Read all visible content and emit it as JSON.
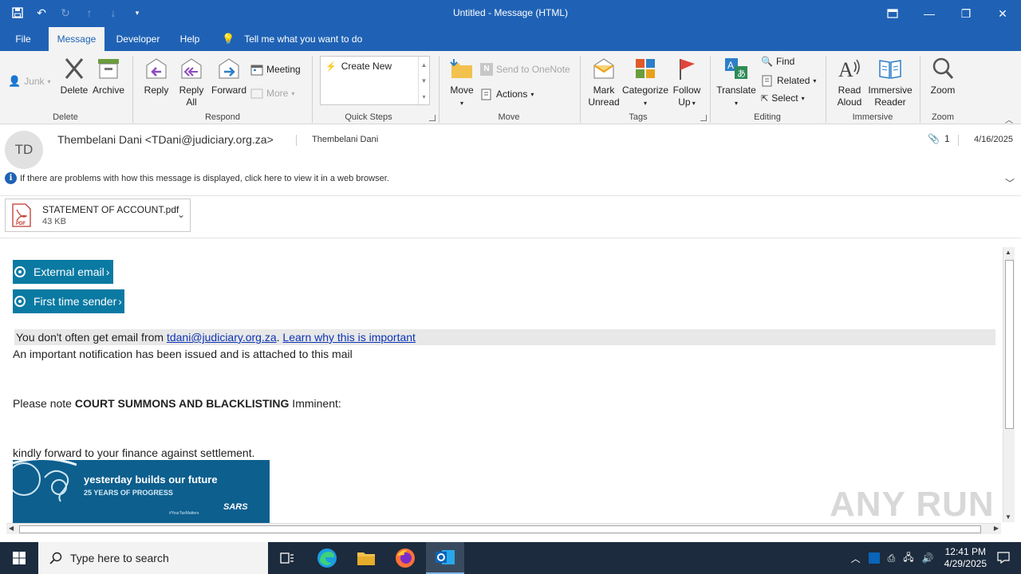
{
  "window": {
    "title": "Untitled  -  Message (HTML)"
  },
  "tabs": [
    "File",
    "Message",
    "Developer",
    "Help"
  ],
  "tell_me": "Tell me what you want to do",
  "ribbon": {
    "junk_label": "Junk",
    "delete_label": "Delete",
    "archive_label": "Archive",
    "group_delete": "Delete",
    "reply_label": "Reply",
    "reply_all_line1": "Reply",
    "reply_all_line2": "All",
    "forward_label": "Forward",
    "meeting_label": "Meeting",
    "more_label": "More",
    "group_respond": "Respond",
    "create_new_label": "Create New",
    "group_quick_steps": "Quick Steps",
    "move_label": "Move",
    "send_onenote_label": "Send to OneNote",
    "actions_label": "Actions",
    "group_move": "Move",
    "mark_unread_line1": "Mark",
    "mark_unread_line2": "Unread",
    "categorize_label": "Categorize",
    "follow_up_line1": "Follow",
    "follow_up_line2": "Up",
    "group_tags": "Tags",
    "translate_label": "Translate",
    "find_label": "Find",
    "related_label": "Related",
    "select_label": "Select",
    "group_editing": "Editing",
    "read_aloud_line1": "Read",
    "read_aloud_line2": "Aloud",
    "immersive_line1": "Immersive",
    "immersive_line2": "Reader",
    "group_immersive": "Immersive",
    "zoom_label": "Zoom",
    "group_zoom": "Zoom"
  },
  "header": {
    "avatar_initials": "TD",
    "from": "Thembelani Dani <TDani@judiciary.org.za>",
    "to": "Thembelani Dani",
    "attachment_count": "1",
    "date": "4/16/2025",
    "info_text": "If there are problems with how this message is displayed, click here to view it in a web browser."
  },
  "attachment": {
    "name": "STATEMENT OF ACCOUNT.pdf",
    "size": "43 KB",
    "icon_text": "PDF"
  },
  "body": {
    "tag_external": "External email",
    "tag_first_time": "First time sender",
    "notice_prefix": "You don't often get email from ",
    "notice_email": "tdani@judiciary.org.za",
    "notice_dot": ". ",
    "notice_link": "Learn why this is important",
    "line1": "An important notification has been issued and is attached to this mail",
    "line2_prefix": "Please note ",
    "line2_bold": "COURT SUMMONS AND BLACKLISTING",
    "line2_suffix": " Imminent:",
    "line3": "kindly forward to your finance against settlement.",
    "banner_line1": "yesterday builds our future",
    "banner_line2": "25 YEARS OF PROGRESS",
    "banner_hashtag": "#YourTaxMatters",
    "banner_logo": "SARS"
  },
  "watermark": "ANY RUN",
  "taskbar": {
    "search_placeholder": "Type here to search",
    "time": "12:41 PM",
    "date": "4/29/2025"
  },
  "colors": {
    "title_blue": "#1f62b5",
    "tag_teal": "#0a7aa3",
    "link_blue": "#0d34b5",
    "taskbar": "#1c2b3d"
  }
}
